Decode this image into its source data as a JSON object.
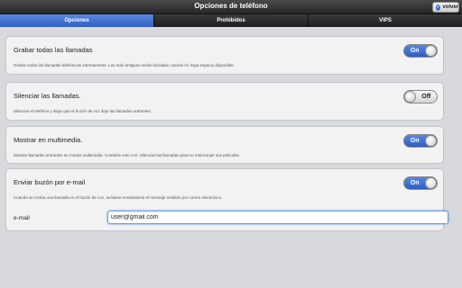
{
  "header": {
    "title": "Opciones de teléfono",
    "back_label": "volver"
  },
  "tabs": [
    {
      "label": "Opciones",
      "active": true
    },
    {
      "label": "Prohibidos",
      "active": false
    },
    {
      "label": "VIPS",
      "active": false
    }
  ],
  "settings": [
    {
      "title": "Grabar todas las llamadas",
      "description": "Grabar todas las llamadas telefónicas internamente. Las más antiguas serán borradas cuando no haya espacio disponible.",
      "toggle_label": "On",
      "enabled": true
    },
    {
      "title": "Silenciar las llamadas.",
      "description": "Silenciar el teléfono y dejar que el buzón de voz deje las llamadas entrantes.",
      "toggle_label": "Off",
      "enabled": false
    },
    {
      "title": "Mostrar en multimedia.",
      "description": "Mostrar llamadas entrantes en modos multimedia. Combine esto con: Silenciar las llamadas para no interrumpir sus películas.",
      "toggle_label": "On",
      "enabled": true
    },
    {
      "title": "Enviar buzón por e-mail",
      "description": "Cuando se reciba una llamada en el buzón de voz, avísame enviándome el mensaje recibido por correo electrónico.",
      "toggle_label": "On",
      "enabled": true,
      "email_label": "e-mail",
      "email_value": "user@gmail.com"
    }
  ],
  "colors": {
    "accent": "#2f5fc4",
    "header": "#2b2b2b"
  }
}
